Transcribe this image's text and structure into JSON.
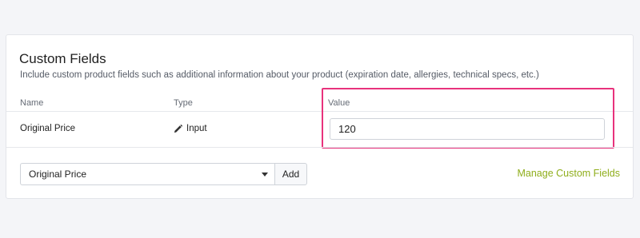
{
  "section": {
    "title": "Custom Fields",
    "description": "Include custom product fields such as additional information about your product (expiration date, allergies, technical specs, etc.)"
  },
  "table": {
    "columns": [
      "Name",
      "Type",
      "Value"
    ],
    "rows": [
      {
        "name": "Original Price",
        "type": "Input",
        "type_icon": "pencil-icon",
        "value": "120"
      }
    ]
  },
  "add_field": {
    "selected_option": "Original Price",
    "add_label": "Add"
  },
  "manage_link": {
    "label": "Manage Custom Fields",
    "color": "#8fae1b"
  },
  "highlight_color": "#e8327c"
}
